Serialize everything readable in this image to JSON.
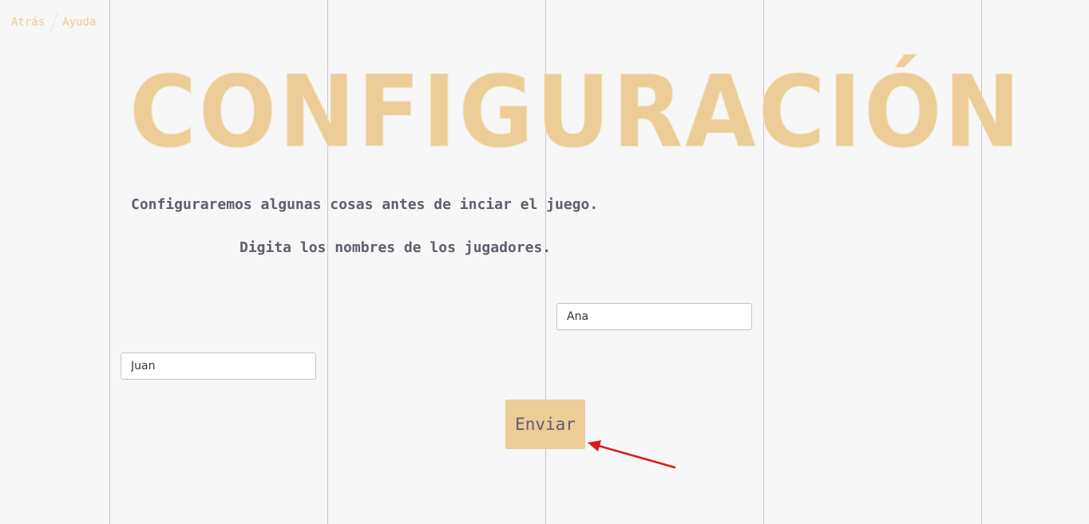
{
  "breadcrumb": {
    "back": "Atrás",
    "help": "Ayuda"
  },
  "title": "CONFIGURACIÓN",
  "intro_text": "Configuraremos algunas cosas antes de inciar el juego.",
  "instruction_text": "Digita los nombres de los jugadores.",
  "players": {
    "player1": "Juan",
    "player2": "Ana"
  },
  "submit_label": "Enviar",
  "colors": {
    "accent": "#eccc97",
    "text": "#5e5e6e",
    "background": "#f7f7f7",
    "annotation_arrow": "#e01818"
  }
}
